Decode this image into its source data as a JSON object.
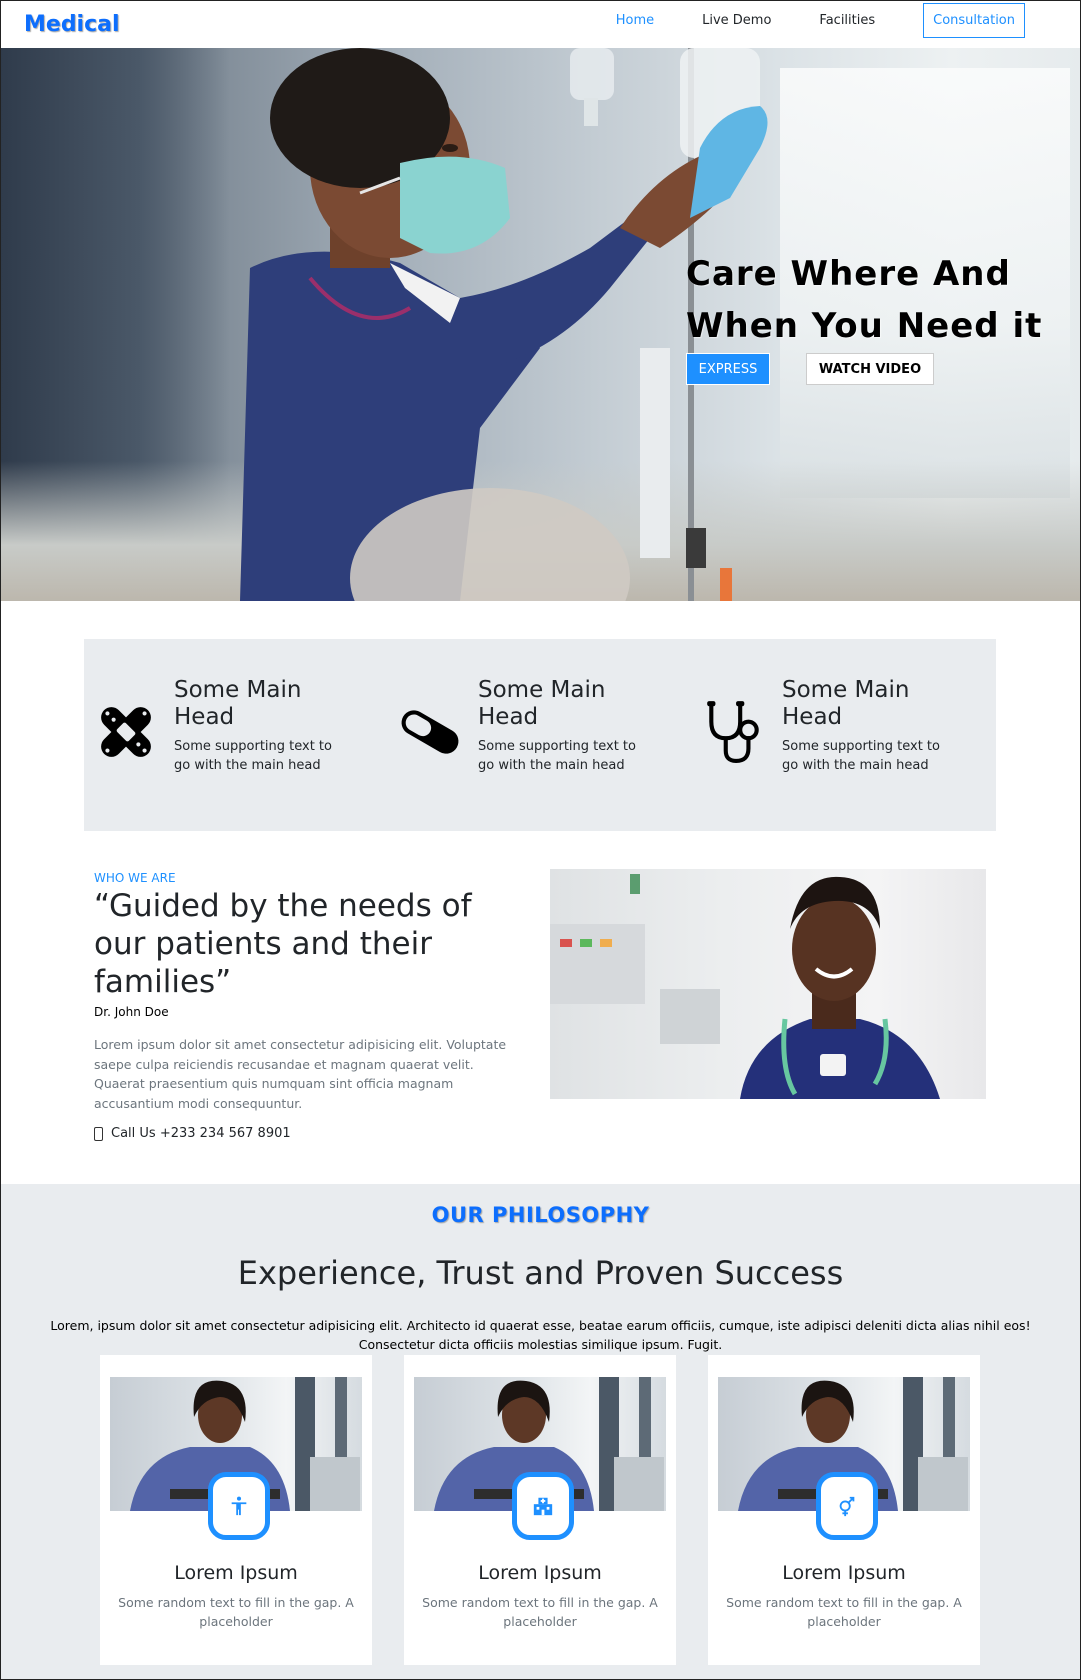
{
  "brand": "Medical",
  "nav": {
    "items": [
      {
        "label": "Home",
        "active": true
      },
      {
        "label": "Live Demo",
        "active": false
      },
      {
        "label": "Facilities",
        "active": false
      },
      {
        "label": "Consultation",
        "outlined": true
      }
    ]
  },
  "hero": {
    "title_line1": "Care Where And",
    "title_line2": "When You Need it",
    "primary_button": "EXPRESS",
    "secondary_button": "WATCH VIDEO"
  },
  "features": [
    {
      "icon": "bandage-icon",
      "head": "Some Main Head",
      "text": "Some supporting text to go with the main head"
    },
    {
      "icon": "pill-capsule-icon",
      "head": "Some Main Head",
      "text": "Some supporting text to go with the main head"
    },
    {
      "icon": "stethoscope-icon",
      "head": "Some Main Head",
      "text": "Some supporting text to go with the main head"
    }
  ],
  "about": {
    "label": "WHO WE ARE",
    "quote": "“Guided by the needs of our patients and their families”",
    "author": "Dr. John Doe",
    "body": "Lorem ipsum dolor sit amet consectetur adipisicing elit. Voluptate saepe culpa reiciendis recusandae et magnam quaerat velit. Quaerat praesentium quis numquam sint officia magnam accusantium modi consequuntur.",
    "call": "Call Us +233 234 567 8901"
  },
  "philosophy": {
    "label": "OUR PHILOSOPHY",
    "title": "Experience, Trust and Proven Success",
    "body": "Lorem, ipsum dolor sit amet consectetur adipisicing elit. Architecto id quaerat esse, beatae earum officiis, cumque, iste adipisci deleniti dicta alias nihil eos! Consectetur dicta officiis molestias similique ipsum. Fugit.",
    "cards": [
      {
        "icon": "accessibility-icon",
        "title": "Lorem Ipsum",
        "text": "Some random text to fill in the gap. A placeholder"
      },
      {
        "icon": "hospital-icon",
        "title": "Lorem Ipsum",
        "text": "Some random text to fill in the gap. A placeholder"
      },
      {
        "icon": "gender-icon",
        "title": "Lorem Ipsum",
        "text": "Some random text to fill in the gap. A placeholder"
      }
    ]
  },
  "colors": {
    "accent": "#1e90ff",
    "brand": "#0d6efd",
    "panel": "#e9ecef"
  }
}
